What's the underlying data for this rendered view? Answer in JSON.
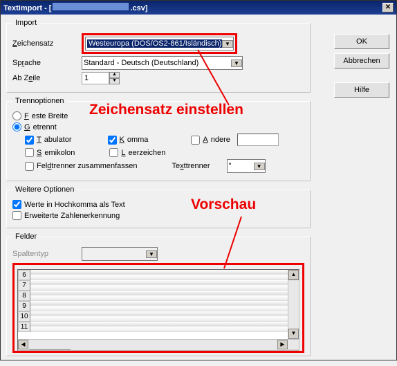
{
  "title_prefix": "Textimport - [",
  "title_suffix": ".csv]",
  "buttons": {
    "ok": "OK",
    "cancel": "Abbrechen",
    "help": "Hilfe"
  },
  "import": {
    "legend": "Import",
    "zeichensatz_label": "Zeichensatz",
    "zeichensatz_value": "Westeuropa (DOS/OS2-861/Isländisch)",
    "sprache_label": "Sprache",
    "sprache_value": "Standard - Deutsch (Deutschland)",
    "abzeile_label": "Ab Zeile",
    "abzeile_value": "1"
  },
  "trenn": {
    "legend": "Trennoptionen",
    "feste_breite": "Feste Breite",
    "getrennt": "Getrennt",
    "tabulator": "Tabulator",
    "komma": "Komma",
    "andere": "Andere",
    "semikolon": "Semikolon",
    "leerzeichen": "Leerzeichen",
    "feldtrenner": "Feldtrenner zusammenfassen",
    "texttrenner": "Texttrenner",
    "texttrenner_value": "\""
  },
  "weitere": {
    "legend": "Weitere Optionen",
    "hochkomma": "Werte in Hochkomma als Text",
    "zahlenerk": "Erweiterte Zahlenerkennung"
  },
  "felder": {
    "legend": "Felder",
    "spaltentyp": "Spaltentyp"
  },
  "preview_rows": [
    "6",
    "7",
    "8",
    "9",
    "10",
    "11"
  ],
  "annotations": {
    "zeichensatz": "Zeichensatz einstellen",
    "vorschau": "Vorschau"
  }
}
